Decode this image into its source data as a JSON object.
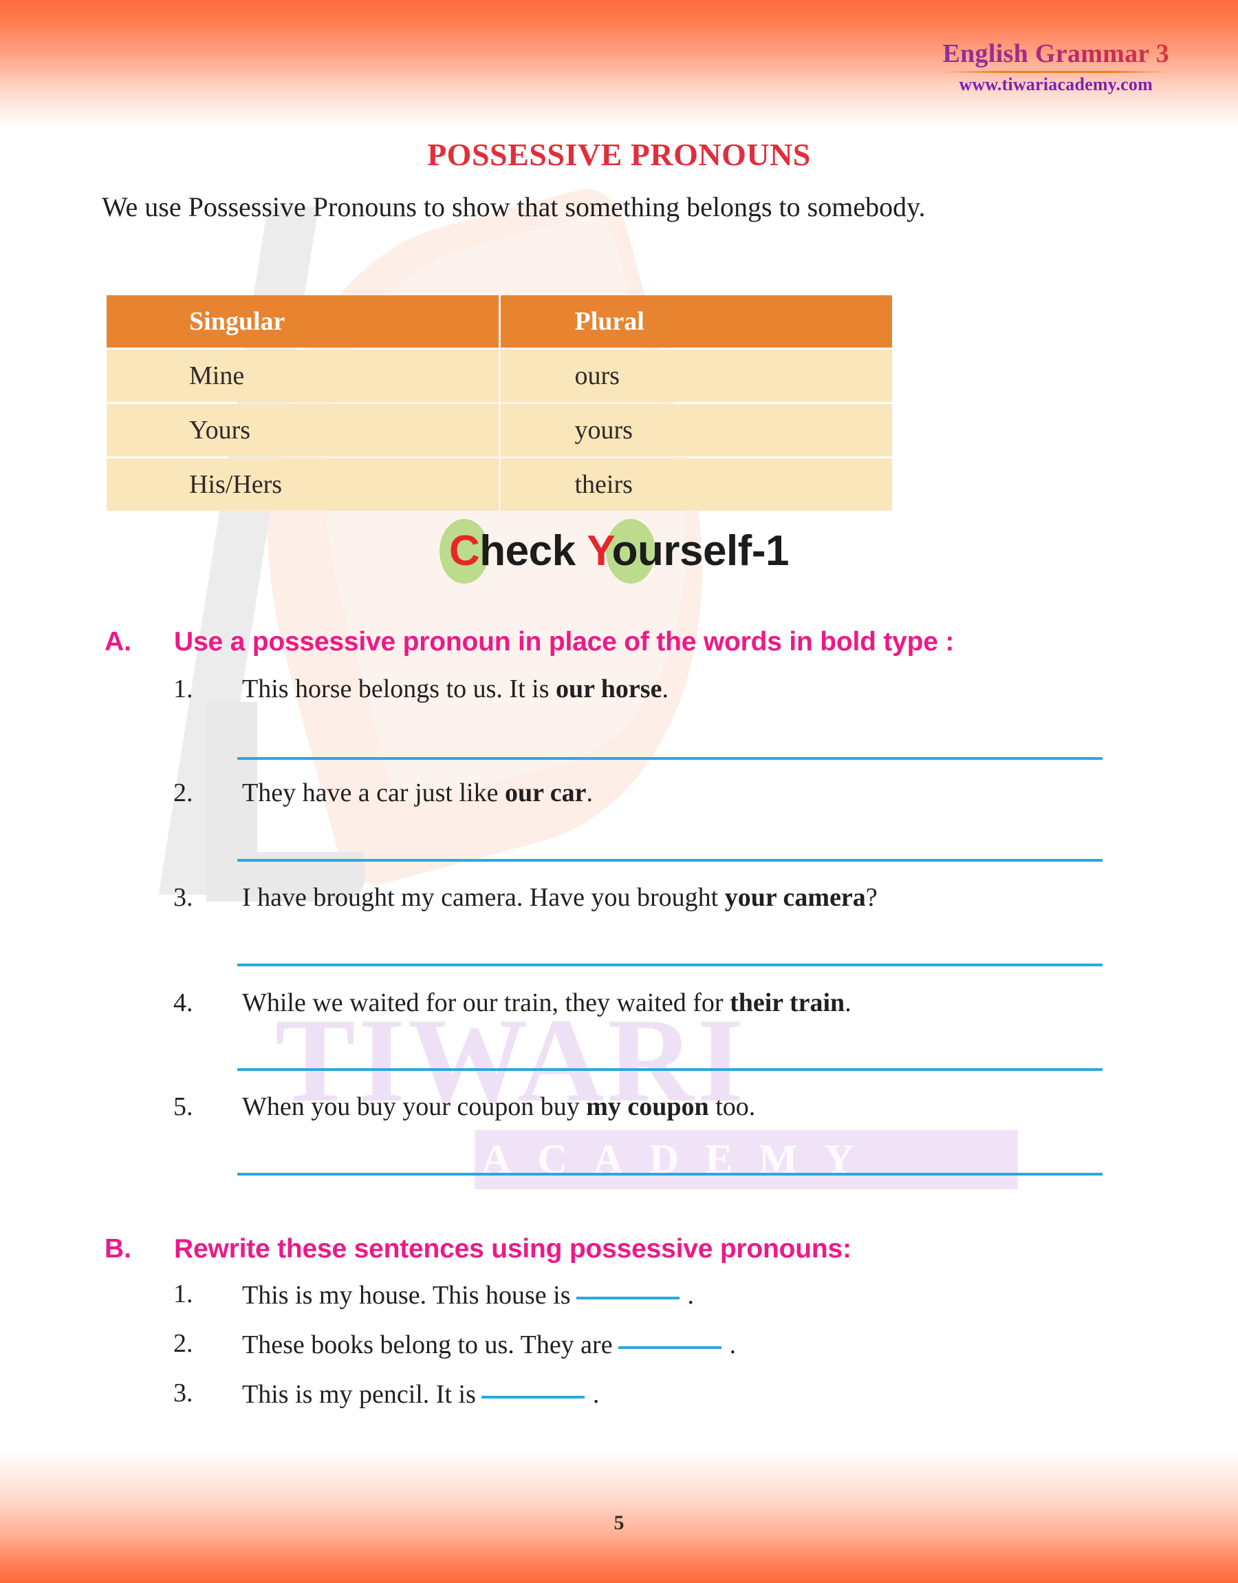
{
  "brand": {
    "title": "English Grammar 3",
    "url": "www.tiwariacademy.com"
  },
  "watermark": {
    "word": "TIWARI",
    "sub": "ACADEMY"
  },
  "doc": {
    "title": "POSSESSIVE PRONOUNS",
    "intro": "We use Possessive Pronouns to show that something belongs to somebody.",
    "page_number": "5"
  },
  "table": {
    "headers": [
      "Singular",
      "Plural"
    ],
    "rows": [
      [
        "Mine",
        "ours"
      ],
      [
        "Yours",
        "yours"
      ],
      [
        "His/Hers",
        "theirs"
      ]
    ]
  },
  "check_yourself": {
    "word1_cap": "C",
    "word1_rest": "heck",
    "word2_cap": "Y",
    "word2_rest": "ourself-1"
  },
  "section_a": {
    "letter": "A.",
    "heading": "Use a possessive pronoun in place of the words in bold type :",
    "items": [
      {
        "num": "1.",
        "pre": "This horse belongs to us. It is ",
        "bold": "our horse",
        "post": "."
      },
      {
        "num": "2.",
        "pre": "They have a car just like ",
        "bold": "our car",
        "post": "."
      },
      {
        "num": "3.",
        "pre": "I have brought my camera. Have you brought ",
        "bold": "your camera",
        "post": "?"
      },
      {
        "num": "4.",
        "pre": "While we waited for our train, they waited for ",
        "bold": "their train",
        "post": "."
      },
      {
        "num": "5.",
        "pre": "When you buy your coupon buy ",
        "bold": "my coupon",
        "post": " too."
      }
    ]
  },
  "section_b": {
    "letter": "B.",
    "heading": "Rewrite these sentences using possessive pronouns:",
    "items": [
      {
        "num": "1.",
        "pre": "This is my house. This house is",
        "post": "."
      },
      {
        "num": "2.",
        "pre": "These books belong to us. They are",
        "post": "."
      },
      {
        "num": "3.",
        "pre": "This is my pencil. It is",
        "post": "."
      }
    ]
  },
  "colors": {
    "accent_orange": "#e8832f",
    "title_red": "#e02f3c",
    "section_pink": "#ec1a87",
    "line_blue": "#29a8e0",
    "table_row": "#fae6bb",
    "blob_green": "#bcdb8d",
    "brand_purple": "#7d1fb5"
  }
}
